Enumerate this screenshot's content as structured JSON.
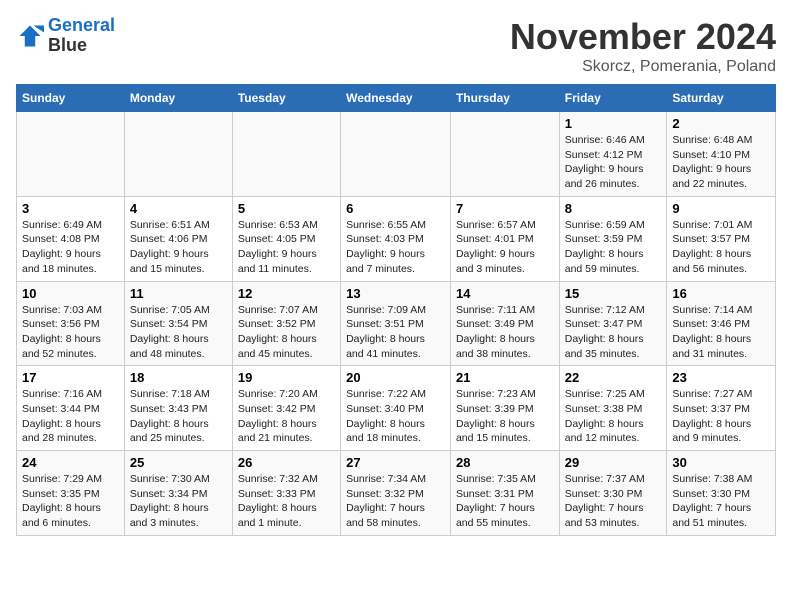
{
  "logo": {
    "line1": "General",
    "line2": "Blue"
  },
  "title": "November 2024",
  "subtitle": "Skorcz, Pomerania, Poland",
  "days_of_week": [
    "Sunday",
    "Monday",
    "Tuesday",
    "Wednesday",
    "Thursday",
    "Friday",
    "Saturday"
  ],
  "weeks": [
    [
      {
        "day": "",
        "info": ""
      },
      {
        "day": "",
        "info": ""
      },
      {
        "day": "",
        "info": ""
      },
      {
        "day": "",
        "info": ""
      },
      {
        "day": "",
        "info": ""
      },
      {
        "day": "1",
        "info": "Sunrise: 6:46 AM\nSunset: 4:12 PM\nDaylight: 9 hours\nand 26 minutes."
      },
      {
        "day": "2",
        "info": "Sunrise: 6:48 AM\nSunset: 4:10 PM\nDaylight: 9 hours\nand 22 minutes."
      }
    ],
    [
      {
        "day": "3",
        "info": "Sunrise: 6:49 AM\nSunset: 4:08 PM\nDaylight: 9 hours\nand 18 minutes."
      },
      {
        "day": "4",
        "info": "Sunrise: 6:51 AM\nSunset: 4:06 PM\nDaylight: 9 hours\nand 15 minutes."
      },
      {
        "day": "5",
        "info": "Sunrise: 6:53 AM\nSunset: 4:05 PM\nDaylight: 9 hours\nand 11 minutes."
      },
      {
        "day": "6",
        "info": "Sunrise: 6:55 AM\nSunset: 4:03 PM\nDaylight: 9 hours\nand 7 minutes."
      },
      {
        "day": "7",
        "info": "Sunrise: 6:57 AM\nSunset: 4:01 PM\nDaylight: 9 hours\nand 3 minutes."
      },
      {
        "day": "8",
        "info": "Sunrise: 6:59 AM\nSunset: 3:59 PM\nDaylight: 8 hours\nand 59 minutes."
      },
      {
        "day": "9",
        "info": "Sunrise: 7:01 AM\nSunset: 3:57 PM\nDaylight: 8 hours\nand 56 minutes."
      }
    ],
    [
      {
        "day": "10",
        "info": "Sunrise: 7:03 AM\nSunset: 3:56 PM\nDaylight: 8 hours\nand 52 minutes."
      },
      {
        "day": "11",
        "info": "Sunrise: 7:05 AM\nSunset: 3:54 PM\nDaylight: 8 hours\nand 48 minutes."
      },
      {
        "day": "12",
        "info": "Sunrise: 7:07 AM\nSunset: 3:52 PM\nDaylight: 8 hours\nand 45 minutes."
      },
      {
        "day": "13",
        "info": "Sunrise: 7:09 AM\nSunset: 3:51 PM\nDaylight: 8 hours\nand 41 minutes."
      },
      {
        "day": "14",
        "info": "Sunrise: 7:11 AM\nSunset: 3:49 PM\nDaylight: 8 hours\nand 38 minutes."
      },
      {
        "day": "15",
        "info": "Sunrise: 7:12 AM\nSunset: 3:47 PM\nDaylight: 8 hours\nand 35 minutes."
      },
      {
        "day": "16",
        "info": "Sunrise: 7:14 AM\nSunset: 3:46 PM\nDaylight: 8 hours\nand 31 minutes."
      }
    ],
    [
      {
        "day": "17",
        "info": "Sunrise: 7:16 AM\nSunset: 3:44 PM\nDaylight: 8 hours\nand 28 minutes."
      },
      {
        "day": "18",
        "info": "Sunrise: 7:18 AM\nSunset: 3:43 PM\nDaylight: 8 hours\nand 25 minutes."
      },
      {
        "day": "19",
        "info": "Sunrise: 7:20 AM\nSunset: 3:42 PM\nDaylight: 8 hours\nand 21 minutes."
      },
      {
        "day": "20",
        "info": "Sunrise: 7:22 AM\nSunset: 3:40 PM\nDaylight: 8 hours\nand 18 minutes."
      },
      {
        "day": "21",
        "info": "Sunrise: 7:23 AM\nSunset: 3:39 PM\nDaylight: 8 hours\nand 15 minutes."
      },
      {
        "day": "22",
        "info": "Sunrise: 7:25 AM\nSunset: 3:38 PM\nDaylight: 8 hours\nand 12 minutes."
      },
      {
        "day": "23",
        "info": "Sunrise: 7:27 AM\nSunset: 3:37 PM\nDaylight: 8 hours\nand 9 minutes."
      }
    ],
    [
      {
        "day": "24",
        "info": "Sunrise: 7:29 AM\nSunset: 3:35 PM\nDaylight: 8 hours\nand 6 minutes."
      },
      {
        "day": "25",
        "info": "Sunrise: 7:30 AM\nSunset: 3:34 PM\nDaylight: 8 hours\nand 3 minutes."
      },
      {
        "day": "26",
        "info": "Sunrise: 7:32 AM\nSunset: 3:33 PM\nDaylight: 8 hours\nand 1 minute."
      },
      {
        "day": "27",
        "info": "Sunrise: 7:34 AM\nSunset: 3:32 PM\nDaylight: 7 hours\nand 58 minutes."
      },
      {
        "day": "28",
        "info": "Sunrise: 7:35 AM\nSunset: 3:31 PM\nDaylight: 7 hours\nand 55 minutes."
      },
      {
        "day": "29",
        "info": "Sunrise: 7:37 AM\nSunset: 3:30 PM\nDaylight: 7 hours\nand 53 minutes."
      },
      {
        "day": "30",
        "info": "Sunrise: 7:38 AM\nSunset: 3:30 PM\nDaylight: 7 hours\nand 51 minutes."
      }
    ]
  ]
}
